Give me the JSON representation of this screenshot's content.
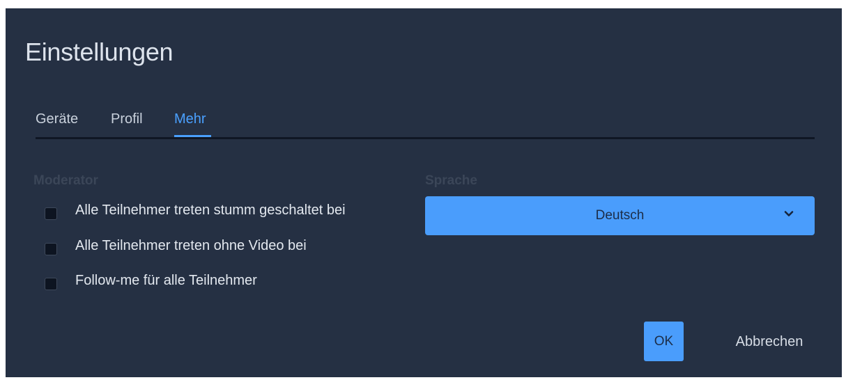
{
  "dialog": {
    "title": "Einstellungen"
  },
  "tabs": [
    {
      "label": "Geräte",
      "active": false
    },
    {
      "label": "Profil",
      "active": false
    },
    {
      "label": "Mehr",
      "active": true
    }
  ],
  "moderator": {
    "heading": "Moderator",
    "options": [
      {
        "label": "Alle Teilnehmer treten stumm geschaltet bei",
        "checked": false
      },
      {
        "label": "Alle Teilnehmer treten ohne Video bei",
        "checked": false
      },
      {
        "label": "Follow-me für alle Teilnehmer",
        "checked": false
      }
    ]
  },
  "language": {
    "heading": "Sprache",
    "selected": "Deutsch"
  },
  "footer": {
    "ok_label": "OK",
    "cancel_label": "Abbrechen"
  },
  "colors": {
    "background": "#253043",
    "accent": "#4a9dfc",
    "active_tab": "#4aa0ff"
  },
  "icons": {
    "select_indicator": "chevron-down-icon"
  }
}
